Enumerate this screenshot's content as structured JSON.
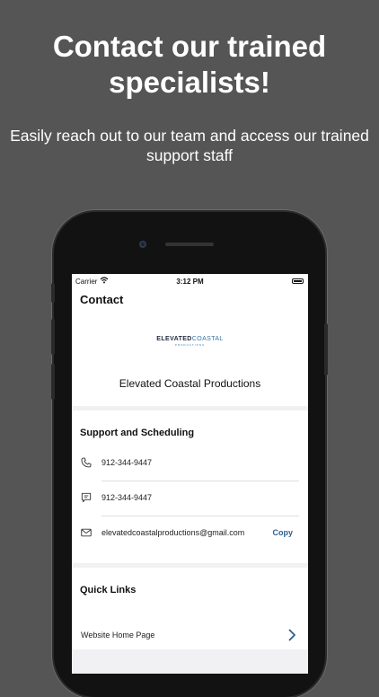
{
  "promo": {
    "headline": "Contact our trained specialists!",
    "subline": "Easily reach out to our team and access our trained support staff"
  },
  "statusbar": {
    "carrier": "Carrier",
    "time": "3:12 PM"
  },
  "nav": {
    "title": "Contact"
  },
  "header": {
    "logo_main_bold": "ELEVATED",
    "logo_main_accent": "COASTAL",
    "logo_sub": "PRODUCTIONS",
    "company_name": "Elevated Coastal Productions"
  },
  "support": {
    "title": "Support and Scheduling",
    "phone": "912-344-9447",
    "sms": "912-344-9447",
    "email": "elevatedcoastalproductions@gmail.com",
    "copy_label": "Copy"
  },
  "quick_links": {
    "title": "Quick Links",
    "items": [
      {
        "label": "Website Home Page"
      }
    ]
  },
  "colors": {
    "background": "#555555",
    "accent": "#2d5f8c",
    "screen_bg": "#f1f1f3"
  }
}
